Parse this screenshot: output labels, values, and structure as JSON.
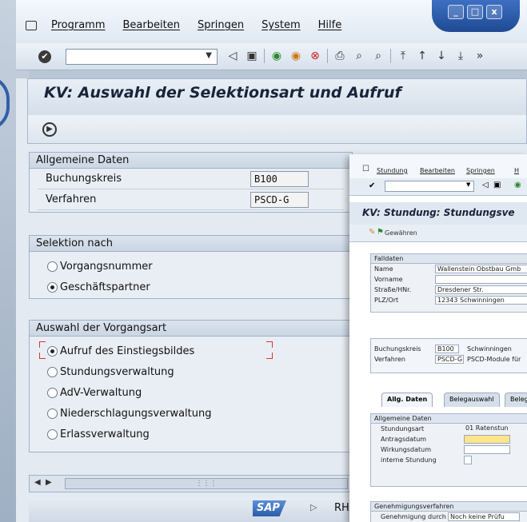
{
  "menu": [
    "Programm",
    "Bearbeiten",
    "Springen",
    "System",
    "Hilfe"
  ],
  "window_buttons": [
    "_",
    "□",
    "x"
  ],
  "toolbar": {
    "command_value": "",
    "overflow": "»"
  },
  "page": {
    "title": "KV: Auswahl der Selektionsart und Aufruf"
  },
  "allgemeine": {
    "header": "Allgemeine Daten",
    "buchungskreis_label": "Buchungskreis",
    "buchungskreis_value": "B100",
    "verfahren_label": "Verfahren",
    "verfahren_value": "PSCD-G"
  },
  "selektion": {
    "header": "Selektion nach",
    "options": [
      "Vorgangsnummer",
      "Geschäftspartner"
    ],
    "selected_index": 1
  },
  "vorgangsart": {
    "header": "Auswahl der Vorgangsart",
    "options": [
      "Aufruf des Einstiegsbildes",
      "Stundungsverwaltung",
      "AdV-Verwaltung",
      "Niederschlagungsverwaltung",
      "Erlassverwaltung"
    ],
    "selected_index": 0
  },
  "status": {
    "logo": "SAP",
    "text": "RHE"
  },
  "overlay": {
    "menu": [
      "Stundung",
      "Bearbeiten",
      "Springen",
      "H"
    ],
    "title": "KV: Stundung: Stundungsve",
    "apptb_text": "Gewähren",
    "falldaten": {
      "header": "Falldaten",
      "rows": [
        {
          "label": "Name",
          "value": "Wallenstein Obstbau Gmb"
        },
        {
          "label": "Vorname",
          "value": ""
        },
        {
          "label": "Straße/HNr.",
          "value": "Dresdener Str."
        },
        {
          "label": "PLZ/Ort",
          "value": "12343 Schwinningen"
        }
      ]
    },
    "bk": {
      "buchungskreis_label": "Buchungskreis",
      "buchungskreis_value": "B100",
      "buchungskreis_text": "Schwinningen",
      "verfahren_label": "Verfahren",
      "verfahren_value": "PSCD-G",
      "verfahren_text": "PSCD-Module für"
    },
    "tabs": [
      "Allg. Daten",
      "Belegauswahl",
      "Beleg"
    ],
    "allg": {
      "header": "Allgemeine Daten",
      "rows": [
        {
          "label": "Stundungsart",
          "value": "01  Ratenstun"
        },
        {
          "label": "Antragsdatum",
          "value": ""
        },
        {
          "label": "Wirkungsdatum",
          "value": ""
        },
        {
          "label": "interne Stundung",
          "value": ""
        }
      ]
    },
    "genehm": {
      "header": "Genehmigungsverfahren",
      "row_label": "Genehmigung durch",
      "row_value": "Noch keine Prüfu"
    }
  }
}
